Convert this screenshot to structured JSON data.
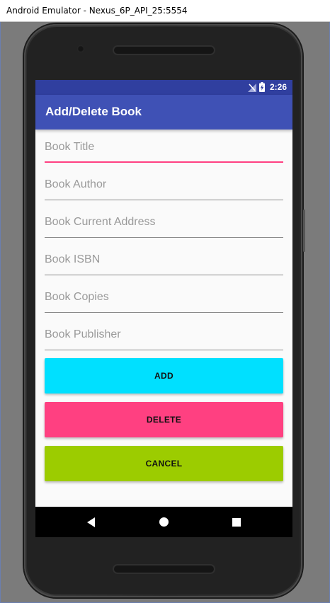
{
  "window": {
    "title": "Android Emulator - Nexus_6P_API_25:5554"
  },
  "statusbar": {
    "time": "2:26",
    "signal_icon": "no-signal-icon",
    "battery_icon": "battery-charging-icon"
  },
  "appbar": {
    "title": "Add/Delete Book"
  },
  "form": {
    "fields": [
      {
        "placeholder": "Book Title",
        "focused": true
      },
      {
        "placeholder": "Book Author"
      },
      {
        "placeholder": "Book Current Address"
      },
      {
        "placeholder": "Book ISBN"
      },
      {
        "placeholder": "Book Copies"
      },
      {
        "placeholder": "Book Publisher"
      }
    ]
  },
  "buttons": {
    "add": {
      "label": "ADD",
      "color": "#00e0ff"
    },
    "delete": {
      "label": "DELETE",
      "color": "#ff4081"
    },
    "cancel": {
      "label": "CANCEL",
      "color": "#9ccc00"
    }
  },
  "colors": {
    "primary": "#3f51b5",
    "primary_dark": "#303f9f",
    "accent": "#ff4081"
  },
  "navbar": {
    "back": "back-icon",
    "home": "home-icon",
    "recents": "recents-icon"
  }
}
